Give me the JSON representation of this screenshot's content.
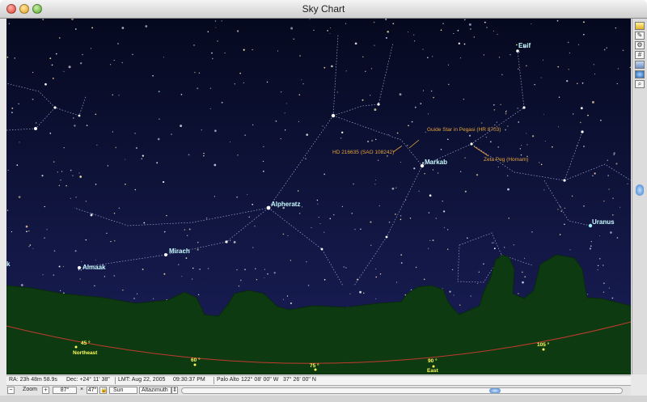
{
  "window": {
    "title": "Sky Chart"
  },
  "sky": {
    "labels": {
      "enif": "Enif",
      "guide_star": "Guide Star in Pegasi (HR 8703)",
      "hd": "HD 216635 (SAO 108242)",
      "markab": "Markab",
      "zeta_peg": "Zeta Peg (Homam)",
      "alpheratz": "Alpheratz",
      "uranus": "Uranus",
      "mirach": "Mirach",
      "almaak": "Almaak",
      "k": "k"
    },
    "horizon": {
      "az45": "45 °",
      "northeast": "Northeast",
      "az60": "60 °",
      "az75": "75 °",
      "az90": "90 °",
      "east": "East",
      "az105": "105 °"
    },
    "colors": {
      "sky_top": "#05091f",
      "sky_bottom": "#1a1f5a",
      "ground": "#0e3a12",
      "star_label": "#c8fbff",
      "guide_label": "#e7a33a",
      "horizon_label": "#fffc5c",
      "ecliptic": "#c23b2e"
    }
  },
  "status": {
    "ra": "RA: 23h 48m 58.9s",
    "dec": "Dec: +24° 11' 38\"",
    "lmt": "LMT: Aug 22, 2005",
    "time": "09:30:37 PM",
    "location": "Palo Alto",
    "longitude": "122° 08' 00\" W",
    "latitude": "37° 26' 00\" N"
  },
  "toolbar": {
    "zoom_out": "−",
    "zoom_label": "Zoom",
    "zoom_in": "+",
    "fov_w": "87°",
    "times": "×",
    "fov_h": "47°",
    "lock_icon": "lock-icon",
    "center_object": "Sun",
    "coord_system": "Altazimuth",
    "stepper": "⇕"
  },
  "rightbar": {
    "icons": [
      "layers-icon",
      "pencil-icon",
      "gear-icon",
      "grid-icon",
      "image-icon",
      "globe-icon",
      "zoom-icon"
    ]
  }
}
